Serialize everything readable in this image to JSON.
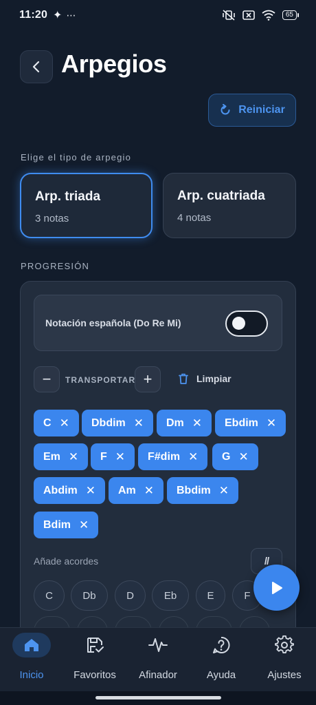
{
  "status_bar": {
    "time": "11:20",
    "sparkle_icon": "sparkle-icon",
    "more_icon": "⋯",
    "battery": "65"
  },
  "header": {
    "title": "Arpegios",
    "back_icon": "chevron-left-icon",
    "reset_label": "Reiniciar"
  },
  "arpeggio_type": {
    "section_label": "Elige el tipo de arpegio",
    "options": [
      {
        "title": "Arp. triada",
        "subtitle": "3 notas",
        "selected": true
      },
      {
        "title": "Arp. cuatriada",
        "subtitle": "4 notas",
        "selected": false
      }
    ]
  },
  "progression": {
    "section_label": "PROGRESIÓN",
    "notation_label": "Notación española (Do Re Mi)",
    "notation_enabled": false,
    "transpose_label": "TRANSPORTAR",
    "minus": "−",
    "plus": "+",
    "clear_label": "Limpiar",
    "chords": [
      "C",
      "Dbdim",
      "Dm",
      "Ebdim",
      "Em",
      "F",
      "F#dim",
      "G",
      "Abdim",
      "Am",
      "Bbdim",
      "Bdim"
    ],
    "remove_glyph": "✕",
    "add_label": "Añade acordes",
    "slash_label": "//",
    "notes": [
      "C",
      "Db",
      "D",
      "Eb",
      "E",
      "F"
    ]
  },
  "bottom_nav": {
    "items": [
      {
        "label": "Inicio",
        "icon": "home-icon",
        "active": true
      },
      {
        "label": "Favoritos",
        "icon": "save-check-icon",
        "active": false
      },
      {
        "label": "Afinador",
        "icon": "waveform-icon",
        "active": false
      },
      {
        "label": "Ayuda",
        "icon": "help-icon",
        "active": false
      },
      {
        "label": "Ajustes",
        "icon": "gear-icon",
        "active": false
      }
    ]
  },
  "colors": {
    "background": "#121c2b",
    "accent": "#3b86ee",
    "accent_text": "#4d94f0",
    "card": "#222d3d"
  }
}
